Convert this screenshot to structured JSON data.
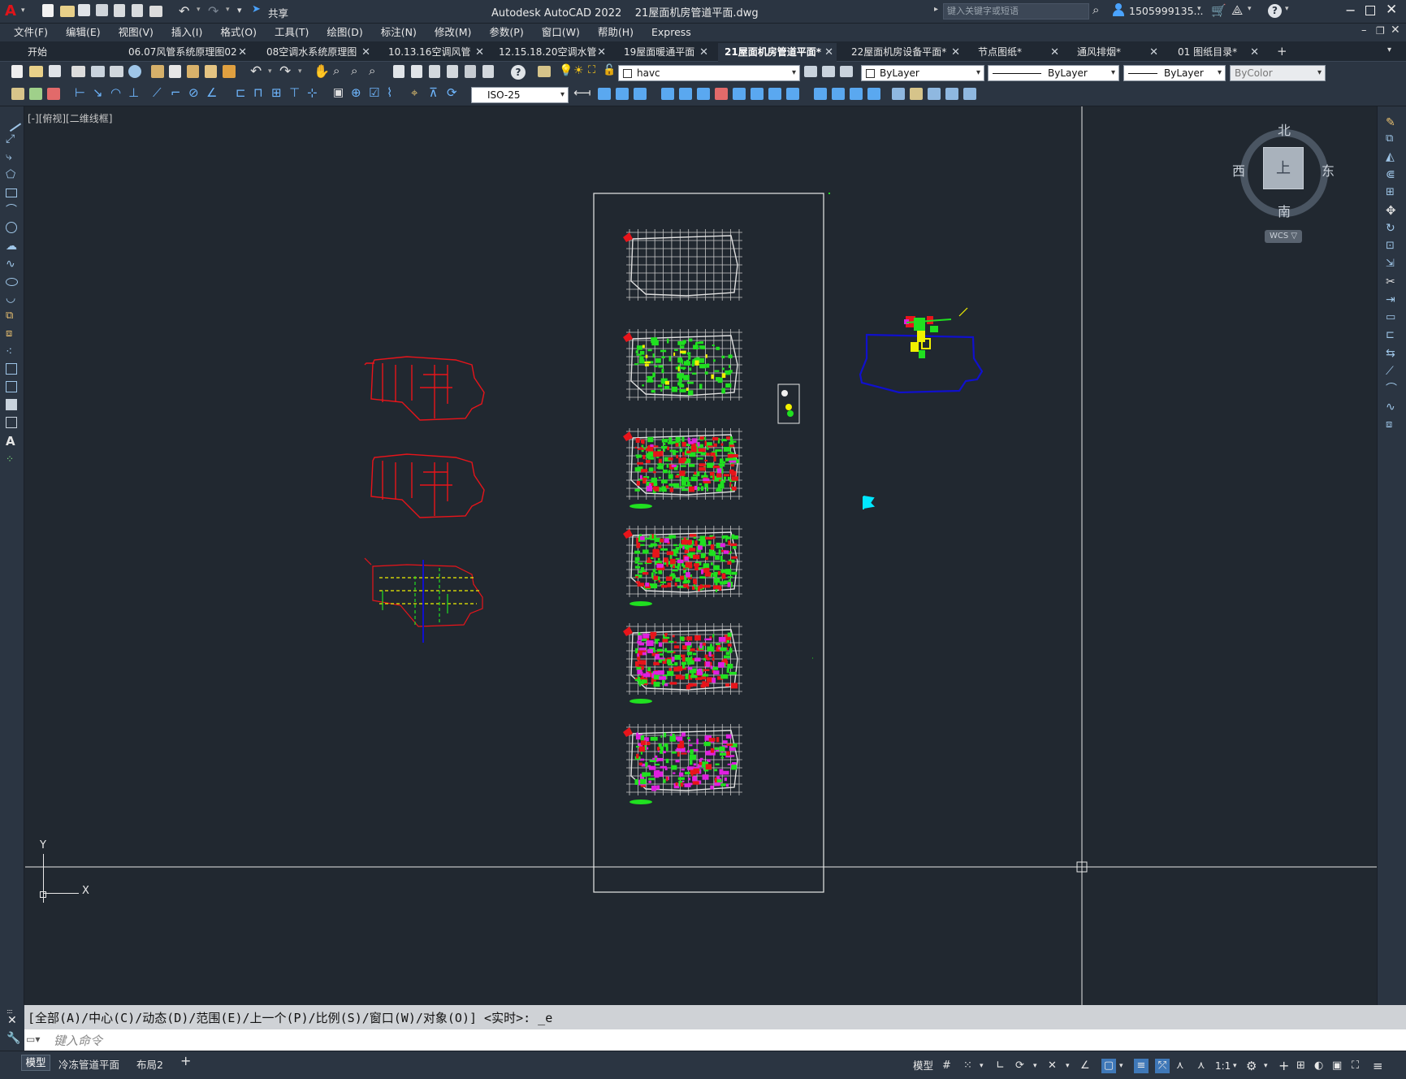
{
  "app": {
    "title": "Autodesk AutoCAD 2022    21屋面机房管道平面.dwg",
    "share_label": "共享",
    "search_placeholder": "键入关键字或短语",
    "user": "1505999135...",
    "logo_letter": "A"
  },
  "menu": [
    "文件(F)",
    "编辑(E)",
    "视图(V)",
    "插入(I)",
    "格式(O)",
    "工具(T)",
    "绘图(D)",
    "标注(N)",
    "修改(M)",
    "参数(P)",
    "窗口(W)",
    "帮助(H)",
    "Express"
  ],
  "tabs": [
    {
      "label": "开始",
      "active": false,
      "closable": false
    },
    {
      "label": "06.07风管系统原理图02",
      "active": false,
      "closable": true
    },
    {
      "label": "08空调水系统原理图",
      "active": false,
      "closable": true
    },
    {
      "label": "10.13.16空调风管",
      "active": false,
      "closable": true
    },
    {
      "label": "12.15.18.20空调水管",
      "active": false,
      "closable": true
    },
    {
      "label": "19屋面暖通平面",
      "active": false,
      "closable": true
    },
    {
      "label": "21屋面机房管道平面*",
      "active": true,
      "closable": true
    },
    {
      "label": "22屋面机房设备平面*",
      "active": false,
      "closable": true
    },
    {
      "label": "节点图纸*",
      "active": false,
      "closable": true
    },
    {
      "label": "通风排烟*",
      "active": false,
      "closable": true
    },
    {
      "label": "01 图纸目录*",
      "active": false,
      "closable": true
    }
  ],
  "properties": {
    "layer": "havc",
    "color": "ByLayer",
    "linetype": "ByLayer",
    "lineweight": "ByLayer",
    "plotstyle": "ByColor",
    "dimstyle": "ISO-25"
  },
  "viewport": {
    "label": "[-][俯视][二维线框]",
    "viewcube_face": "上",
    "compass": {
      "north": "北",
      "south": "南",
      "east": "东",
      "west": "西"
    },
    "wcs": "WCS ▽",
    "ucs_x": "X",
    "ucs_y": "Y"
  },
  "command": {
    "history": "[全部(A)/中心(C)/动态(D)/范围(E)/上一个(P)/比例(S)/窗口(W)/对象(O)] <实时>: _e",
    "placeholder": "键入命令"
  },
  "layout_tabs": [
    {
      "label": "模型",
      "active": true
    },
    {
      "label": "冷冻管道平面",
      "active": false
    },
    {
      "label": "布局2",
      "active": false
    }
  ],
  "status": {
    "model_label": "模型",
    "scale": "1:1"
  },
  "colors": {
    "canvas_bg": "#212830",
    "chrome_bg": "#2b3542",
    "red": "#e8141a",
    "green": "#20e020",
    "magenta": "#e020e0",
    "yellow": "#f0f000",
    "blue": "#1010cc",
    "cyan": "#00e6ff",
    "grid_gray": "#c8c8c8"
  }
}
